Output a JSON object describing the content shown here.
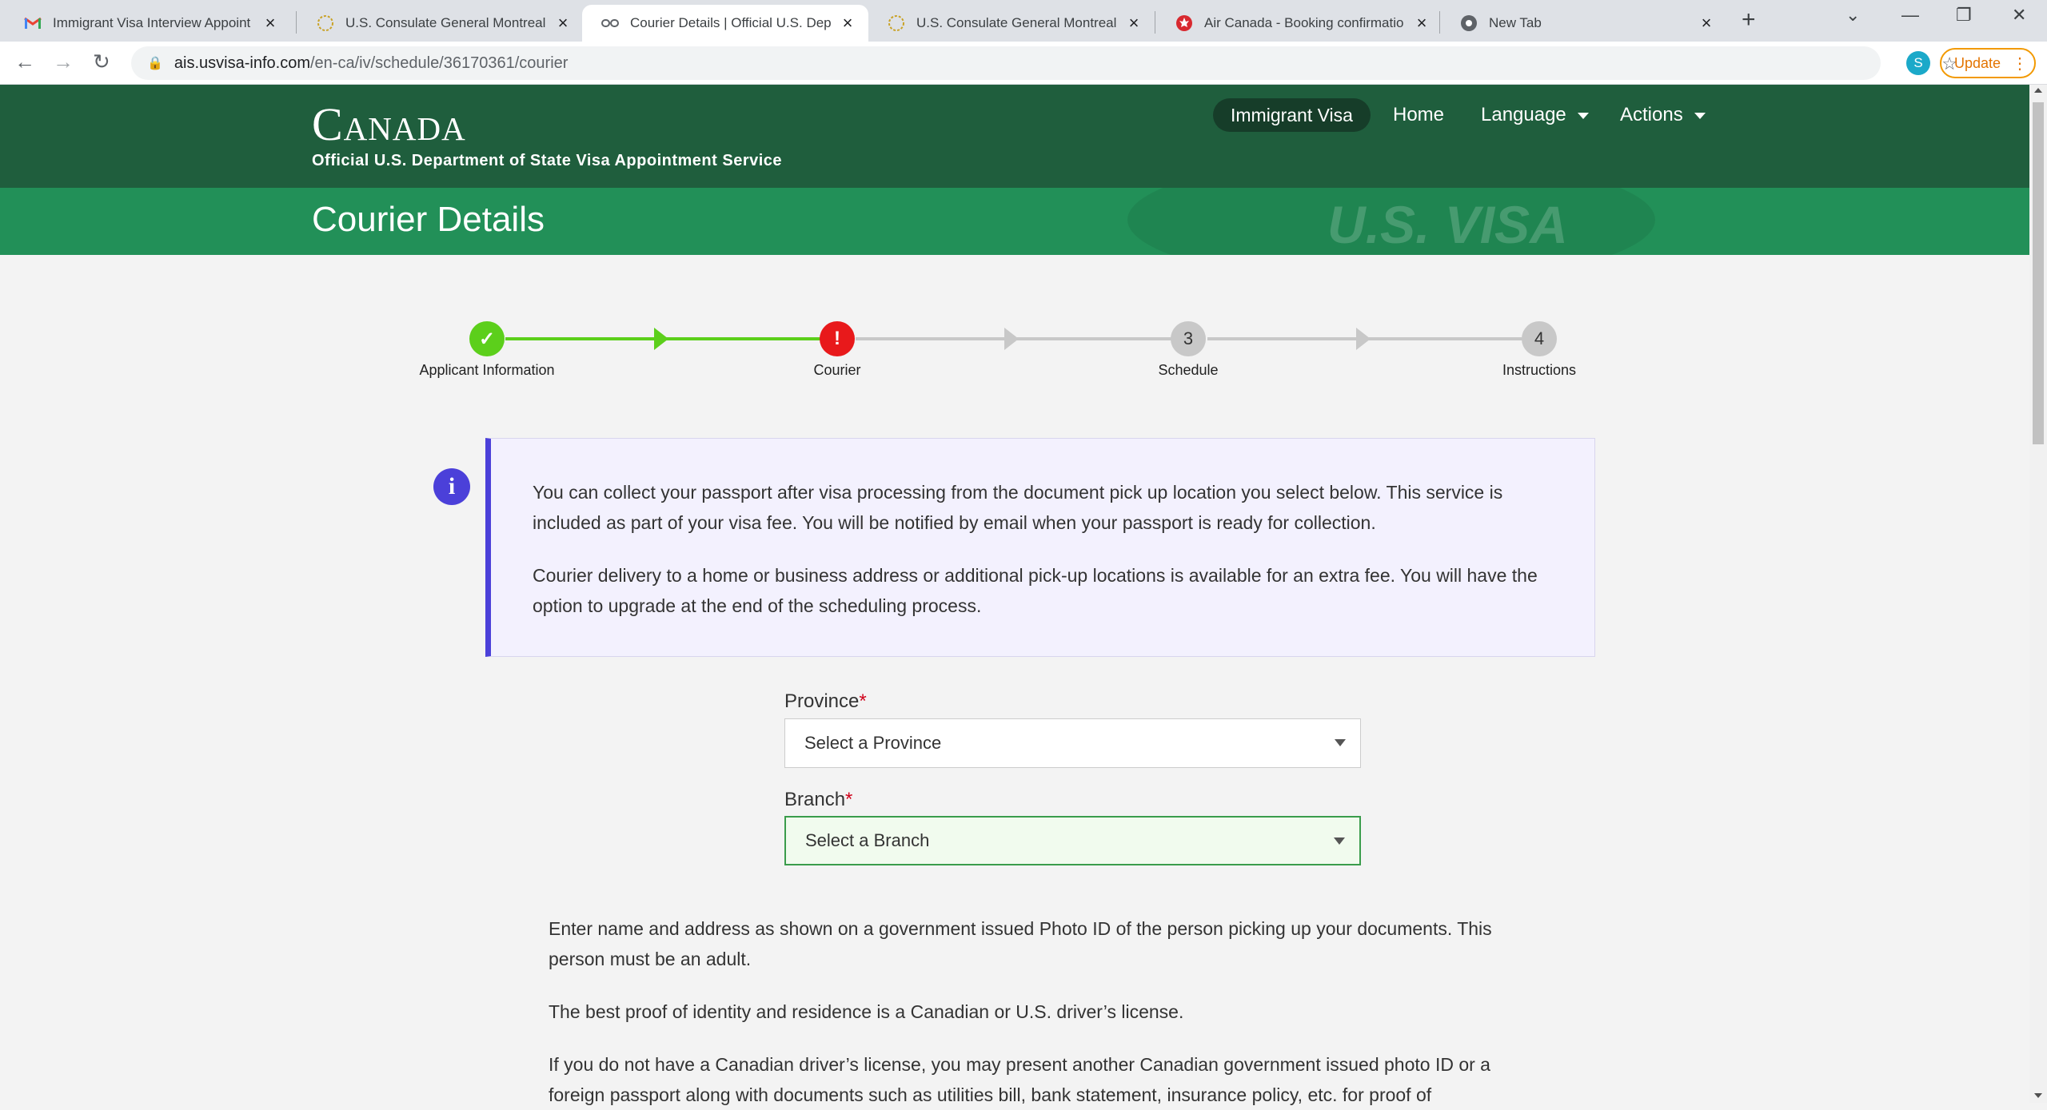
{
  "browser": {
    "tabs": [
      {
        "title": "Immigrant Visa Interview Appoint",
        "favicon": "gmail-icon"
      },
      {
        "title": "U.S. Consulate General Montreal",
        "favicon": "consulate-seal-icon"
      },
      {
        "title": "Courier Details | Official U.S. Dep",
        "favicon": "link-icon",
        "active": true
      },
      {
        "title": "U.S. Consulate General Montreal",
        "favicon": "consulate-seal-icon"
      },
      {
        "title": "Air Canada - Booking confirmatio",
        "favicon": "air-canada-icon"
      },
      {
        "title": "New Tab",
        "favicon": "chrome-icon"
      }
    ],
    "url_host": "ais.usvisa-info.com",
    "url_path": "/en-ca/iv/schedule/36170361/courier",
    "profile_initial": "S",
    "update_label": "Update"
  },
  "header": {
    "country": "Canada",
    "subtitle": "Official U.S. Department of State Visa Appointment Service",
    "nav": {
      "immigrant_visa": "Immigrant Visa",
      "home": "Home",
      "language": "Language",
      "actions": "Actions"
    }
  },
  "banner": {
    "title": "Courier Details",
    "watermark": "U.S. VISA"
  },
  "steps": [
    {
      "label": "Applicant Information",
      "status": "complete",
      "glyph": "✓"
    },
    {
      "label": "Courier",
      "status": "error",
      "glyph": "!"
    },
    {
      "label": "Schedule",
      "status": "pending",
      "glyph": "3"
    },
    {
      "label": "Instructions",
      "status": "pending",
      "glyph": "4"
    }
  ],
  "info": {
    "paragraph1": "You can collect your passport after visa processing from the document pick up location you select below. This service is included as part of your visa fee. You will be notified by email when your passport is ready for collection.",
    "paragraph2": "Courier delivery to a home or business address or additional pick-up locations is available for an extra fee. You will have the option to upgrade at the end of the scheduling process."
  },
  "form": {
    "province_label": "Province",
    "province_value": "Select a Province",
    "branch_label": "Branch",
    "branch_value": "Select a Branch",
    "required_mark": "*"
  },
  "body": {
    "p1": "Enter name and address as shown on a government issued Photo ID of the person picking up your documents. This person must be an adult.",
    "p2": "The best proof of identity and residence is a Canadian or U.S. driver’s license.",
    "p3": "If you do not have a Canadian driver’s license, you may present another Canadian government issued photo ID or a foreign passport along with documents such as utilities bill, bank statement, insurance policy, etc. for proof of"
  },
  "colors": {
    "header_green": "#1f5e3d",
    "banner_green": "#229058",
    "step_complete": "#5ccf1b",
    "step_error": "#e8191b",
    "step_pending": "#c8c8c8",
    "info_accent": "#4b40d9"
  }
}
